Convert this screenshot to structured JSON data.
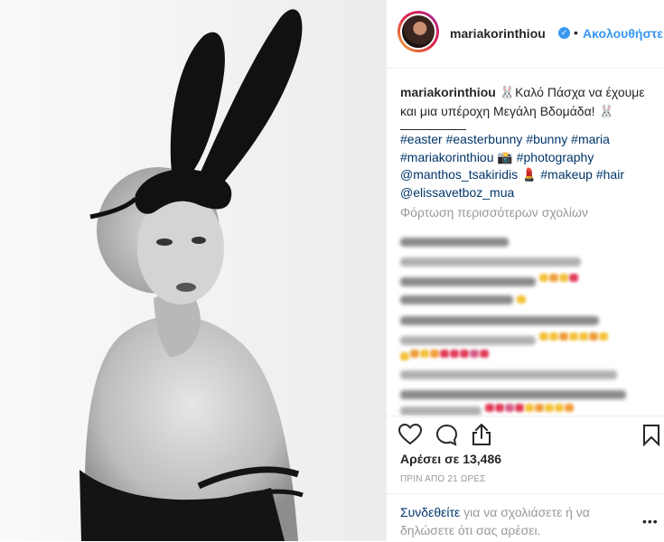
{
  "post": {
    "image_alt": "Black and white portrait of a woman wearing black bunny ears and a mask",
    "username": "mariakorinthiou",
    "verified": true,
    "separator_dot": "•",
    "follow_label": "Ακολουθήστε",
    "caption_username": "mariakorinthiou",
    "caption_text_1": "🐰Καλό Πάσχα να έχουμε και μια υπέροχη Μεγάλη Βδομάδα! 🐰",
    "hashtags_line": "______________",
    "tags": [
      "#easter",
      "#easterbunny",
      "#bunny",
      "#maria",
      "#mariakorinthiou",
      "📸",
      "#photography",
      "@manthos_tsakiridis",
      "💄",
      "#makeup",
      "#hair",
      "@elissavetboz_mua"
    ],
    "load_more_label": "Φόρτωση περισσότερων σχολίων",
    "likes_label": "Αρέσει σε 13,486",
    "timestamp": "ΠΡΙΝ ΑΠΟ 21 ΩΡΕΣ",
    "login_link": "Συνδεθείτε",
    "login_text": " για να σχολιάσετε ή να δηλώσετε ότι σας αρέσει.",
    "more_label": "•••"
  },
  "icons": {
    "verified": "verified-badge-icon",
    "like": "heart-icon",
    "comment": "comment-bubble-icon",
    "share": "share-icon",
    "save": "bookmark-icon"
  },
  "colors": {
    "link": "#003569",
    "follow": "#3897f0",
    "muted": "#999999",
    "text": "#262626"
  }
}
